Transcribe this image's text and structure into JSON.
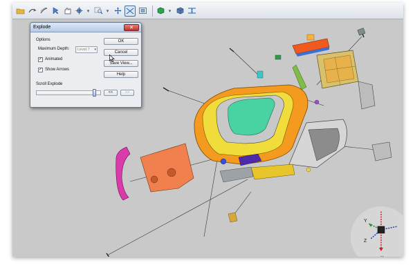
{
  "toolbar": {
    "icons": [
      "open-folder-icon",
      "rotate-icon",
      "pan-icon",
      "select-icon",
      "hand-icon",
      "orbit-icon",
      "zoom-window-icon",
      "zoom-extents-icon",
      "fit-all-icon",
      "view-cube-icon",
      "shaded-icon",
      "box-icon",
      "explode-icon"
    ]
  },
  "dialog": {
    "title": "Explode",
    "close_glyph": "✕",
    "options_label": "Options",
    "max_depth_label": "Maximum Depth:",
    "max_depth_value": "Level 7",
    "animated_label": "Animated",
    "animated_checked": true,
    "show_arrows_label": "Show Arrows",
    "show_arrows_checked": true,
    "scroll_label": "Scroll Explode",
    "scroll_value": 1.0,
    "prev_label": "<<",
    "next_label": ">>",
    "ok_label": "OK",
    "cancel_label": "Cancel",
    "save_view_label": "Save View...",
    "help_label": "Help"
  },
  "triad": {
    "x_label": "X",
    "y_label": "Y",
    "z_label": "Z"
  },
  "colors": {
    "background": "#c9c9c9",
    "axis_x": "#d11f26",
    "axis_y": "#2e8b2e",
    "axis_z": "#1f3fbf"
  }
}
